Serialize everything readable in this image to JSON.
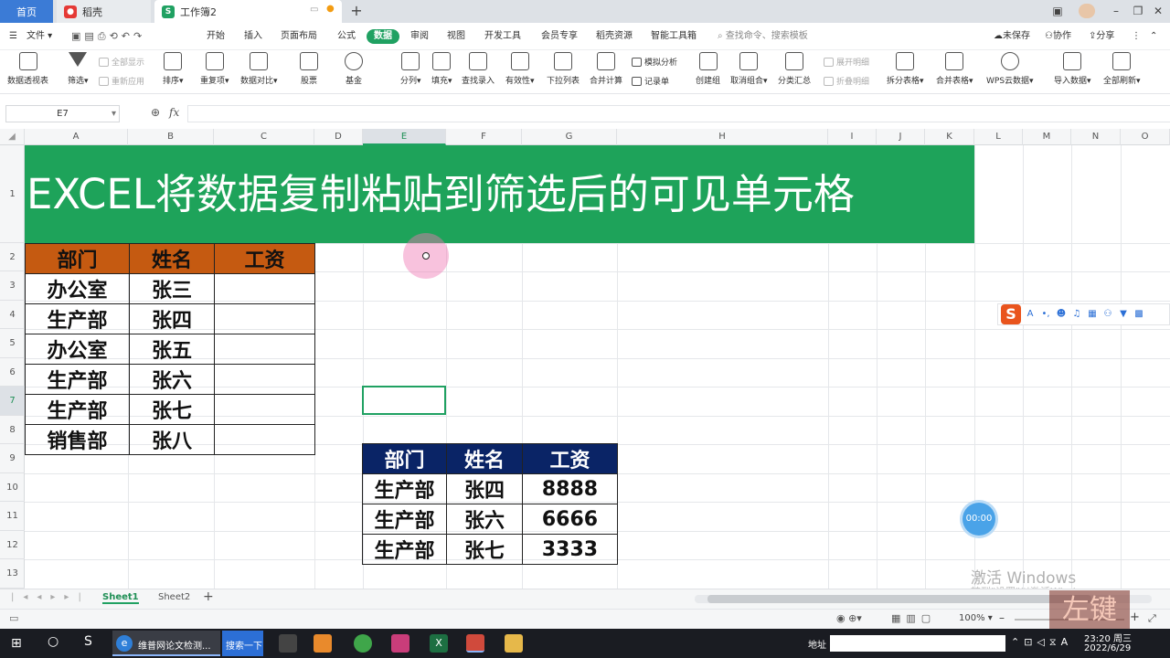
{
  "tabs": {
    "home": "首页",
    "docer": "稻壳",
    "workbook": "工作簿2"
  },
  "menu": [
    "文件",
    "开始",
    "插入",
    "页面布局",
    "公式",
    "数据",
    "审阅",
    "视图",
    "开发工具",
    "会员专享",
    "稻壳资源",
    "智能工具箱"
  ],
  "menu_active": "数据",
  "search_placeholder": "查找命令、搜索模板",
  "right_actions": {
    "unsaved": "未保存",
    "collab": "协作",
    "share": "分享"
  },
  "ribbon": {
    "pivot": "数据透视表",
    "filter": "筛选",
    "show_all": "全部显示",
    "reapply": "重新应用",
    "sort": "排序",
    "duplicates": "重复项",
    "compare": "数据对比",
    "stocks": "股票",
    "fund": "基金",
    "split": "分列",
    "fill": "填充",
    "lookup": "查找录入",
    "validity": "有效性",
    "dropdown": "下拉列表",
    "merge_calc": "合并计算",
    "simulate": "模拟分析",
    "record": "记录单",
    "group": "创建组",
    "ungroup": "取消组合",
    "subtotal": "分类汇总",
    "expand": "展开明细",
    "collapse": "折叠明细",
    "split_table": "拆分表格",
    "merge_table": "合并表格",
    "wps_cloud": "WPS云数据",
    "import": "导入数据",
    "refresh_all": "全部刷新"
  },
  "formula": {
    "cell_ref": "E7",
    "fx": "fx"
  },
  "columns": [
    "A",
    "B",
    "C",
    "D",
    "E",
    "F",
    "G",
    "H",
    "I",
    "J",
    "K",
    "L",
    "M",
    "N",
    "O"
  ],
  "rows": [
    "1",
    "2",
    "3",
    "4",
    "5",
    "6",
    "7",
    "8",
    "9",
    "10",
    "11",
    "12",
    "13"
  ],
  "banner_title": "EXCEL将数据复制粘贴到筛选后的可见单元格",
  "table1": {
    "headers": [
      "部门",
      "姓名",
      "工资"
    ],
    "rows": [
      [
        "办公室",
        "张三",
        ""
      ],
      [
        "生产部",
        "张四",
        ""
      ],
      [
        "办公室",
        "张五",
        ""
      ],
      [
        "生产部",
        "张六",
        ""
      ],
      [
        "生产部",
        "张七",
        ""
      ],
      [
        "销售部",
        "张八",
        ""
      ]
    ]
  },
  "table2": {
    "headers": [
      "部门",
      "姓名",
      "工资"
    ],
    "rows": [
      [
        "生产部",
        "张四",
        "8888"
      ],
      [
        "生产部",
        "张六",
        "6666"
      ],
      [
        "生产部",
        "张七",
        "3333"
      ]
    ]
  },
  "sheets": [
    "Sheet1",
    "Sheet2"
  ],
  "active_sheet": "Sheet1",
  "zoom": "100%",
  "timer": "00:00",
  "watermark": "激活 Windows",
  "watermark_sub": "转到\"设置\"以激活Windows。",
  "stamp": "左键",
  "taskbar": {
    "app1": "维普网论文检测...",
    "search": "搜索一下",
    "address": "地址",
    "time": "23:20 周三",
    "date": "2022/6/29"
  },
  "colors": {
    "accent": "#20a162",
    "banner": "#1ea35a",
    "table1_header": "#c55a11",
    "table2_header": "#0a2466"
  }
}
